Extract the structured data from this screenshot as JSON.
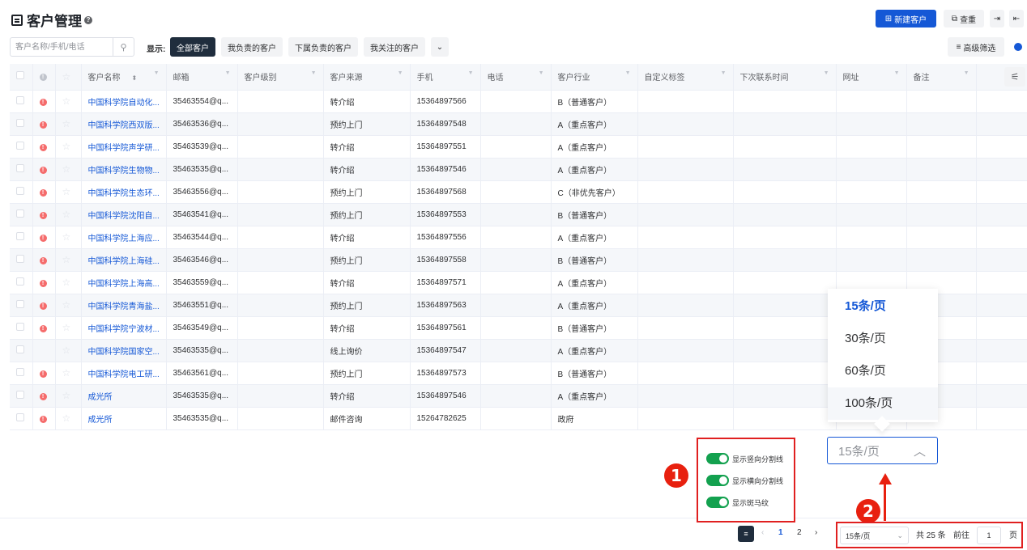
{
  "header": {
    "title": "客户管理",
    "help_icon": "?",
    "new_button": "新建客户",
    "dup_button": "查重"
  },
  "filter": {
    "search_placeholder": "客户名称/手机/电话",
    "show_label": "显示:",
    "tabs": [
      "全部客户",
      "我负责的客户",
      "下属负责的客户",
      "我关注的客户"
    ],
    "advanced": "高级筛选"
  },
  "table": {
    "columns": [
      "客户名称",
      "邮箱",
      "客户级别",
      "客户来源",
      "手机",
      "电话",
      "客户行业",
      "自定义标签",
      "下次联系时间",
      "网址",
      "备注"
    ],
    "rows": [
      {
        "name": "中国科学院自动化...",
        "email": "35463554@q...",
        "source": "转介绍",
        "mobile": "15364897566",
        "industry": "B（普通客户）",
        "dot": true
      },
      {
        "name": "中国科学院西双版...",
        "email": "35463536@q...",
        "source": "预约上门",
        "mobile": "15364897548",
        "industry": "A（重点客户）",
        "dot": true
      },
      {
        "name": "中国科学院声学研...",
        "email": "35463539@q...",
        "source": "转介绍",
        "mobile": "15364897551",
        "industry": "A（重点客户）",
        "dot": true
      },
      {
        "name": "中国科学院生物物...",
        "email": "35463535@q...",
        "source": "转介绍",
        "mobile": "15364897546",
        "industry": "A（重点客户）",
        "dot": true
      },
      {
        "name": "中国科学院生态环...",
        "email": "35463556@q...",
        "source": "预约上门",
        "mobile": "15364897568",
        "industry": "C（非优先客户）",
        "dot": true
      },
      {
        "name": "中国科学院沈阳自...",
        "email": "35463541@q...",
        "source": "预约上门",
        "mobile": "15364897553",
        "industry": "B（普通客户）",
        "dot": true
      },
      {
        "name": "中国科学院上海应...",
        "email": "35463544@q...",
        "source": "转介绍",
        "mobile": "15364897556",
        "industry": "A（重点客户）",
        "dot": true
      },
      {
        "name": "中国科学院上海硅...",
        "email": "35463546@q...",
        "source": "预约上门",
        "mobile": "15364897558",
        "industry": "B（普通客户）",
        "dot": true
      },
      {
        "name": "中国科学院上海高...",
        "email": "35463559@q...",
        "source": "转介绍",
        "mobile": "15364897571",
        "industry": "A（重点客户）",
        "dot": true
      },
      {
        "name": "中国科学院青海盐...",
        "email": "35463551@q...",
        "source": "预约上门",
        "mobile": "15364897563",
        "industry": "A（重点客户）",
        "dot": true
      },
      {
        "name": "中国科学院宁波材...",
        "email": "35463549@q...",
        "source": "转介绍",
        "mobile": "15364897561",
        "industry": "B（普通客户）",
        "dot": true
      },
      {
        "name": "中国科学院国家空...",
        "email": "35463535@q...",
        "source": "线上询价",
        "mobile": "15364897547",
        "industry": "A（重点客户）",
        "dot": false
      },
      {
        "name": "中国科学院电工研...",
        "email": "35463561@q...",
        "source": "预约上门",
        "mobile": "15364897573",
        "industry": "B（普通客户）",
        "dot": true
      },
      {
        "name": "成光所",
        "email": "35463535@q...",
        "source": "转介绍",
        "mobile": "15364897546",
        "industry": "A（重点客户）",
        "dot": true
      },
      {
        "name": "成光所",
        "email": "35463535@q...",
        "source": "邮件咨询",
        "mobile": "15264782625",
        "industry": "政府",
        "dot": true
      }
    ]
  },
  "toggles": [
    "显示竖向分割线",
    "显示横向分割线",
    "显示斑马纹"
  ],
  "annotations": {
    "badge1": "1",
    "badge2": "2"
  },
  "dropdown": {
    "options": [
      "15条/页",
      "30条/页",
      "60条/页",
      "100条/页"
    ],
    "selected": "15条/页"
  },
  "pagination": {
    "pages": [
      "1",
      "2"
    ],
    "current": "1",
    "page_size": "15条/页",
    "total": "共 25 条",
    "goto": "前往",
    "goto_value": "1",
    "page_unit": "页"
  },
  "colors": {
    "primary": "#1558d6",
    "annotation": "#e02020",
    "switch": "#13a14f"
  }
}
